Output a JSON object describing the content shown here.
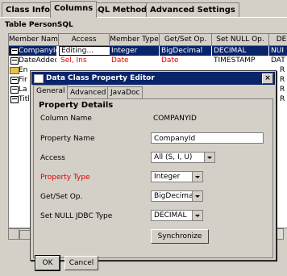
{
  "tabs": [
    {
      "label": "Class Info."
    },
    {
      "label": "Columns"
    },
    {
      "label": "SQL Methods"
    },
    {
      "label": "Advanced Settings"
    }
  ],
  "table_title": "Table PersonSQL",
  "grid": {
    "headers": [
      "Member Name",
      "Access",
      "Member Type",
      "Get/Set Op.",
      "Set NULL Op.",
      "DE"
    ],
    "rows": [
      {
        "cells": [
          "CompanyId",
          "Editing...",
          "Integer",
          "BigDecimal",
          "DECIMAL",
          "NUI"
        ]
      },
      {
        "cells": [
          "DateAdded",
          "Sel, Ins",
          "Date",
          "Date",
          "TIMESTAMP",
          "DAT"
        ]
      },
      {
        "cells": [
          "En",
          "",
          "",
          "",
          "",
          "R"
        ]
      },
      {
        "cells": [
          "Fir",
          "",
          "",
          "",
          "",
          "R"
        ]
      },
      {
        "cells": [
          "La",
          "",
          "",
          "",
          "",
          "R"
        ]
      },
      {
        "cells": [
          "Titl",
          "",
          "",
          "",
          "",
          "R"
        ]
      }
    ]
  },
  "dialog": {
    "title": "Data Class Property Editor",
    "tabs": [
      "General",
      "Advanced",
      "JavaDoc"
    ],
    "section_title": "Property Details",
    "column_name_label": "Column Name",
    "column_name_value": "COMPANYID",
    "property_name_label": "Property Name",
    "property_name_value": "CompanyId",
    "access_label": "Access",
    "access_value": "All (S, I, U)",
    "property_type_label": "Property Type",
    "property_type_value": "Integer",
    "getset_label": "Get/Set Op.",
    "getset_value": "BigDecimal",
    "setnull_label": "Set NULL JDBC Type",
    "setnull_value": "DECIMAL",
    "synchronize_label": "Synchronize",
    "ok_label": "OK",
    "cancel_label": "Cancel",
    "close_glyph": "×"
  },
  "colors": {
    "selection": "#0a246a",
    "error_text": "#dd0000"
  }
}
